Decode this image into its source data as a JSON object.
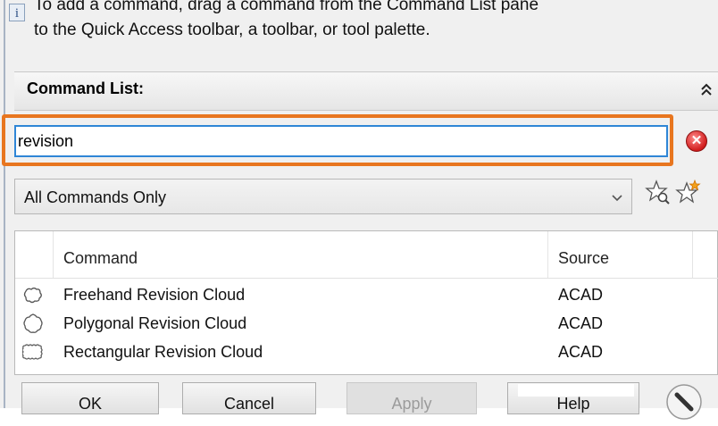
{
  "info": {
    "line1": "To add a command, drag a command from the Command List pane",
    "line2": "to the Quick Access toolbar, a toolbar, or tool palette."
  },
  "command_list": {
    "title": "Command List:"
  },
  "search": {
    "value": "revision"
  },
  "filter": {
    "selected": "All Commands Only"
  },
  "table": {
    "columns": [
      "Command",
      "Source"
    ],
    "rows": [
      {
        "icon": "freehand-revision-cloud-icon",
        "command": "Freehand Revision Cloud",
        "source": "ACAD"
      },
      {
        "icon": "polygonal-revision-cloud-icon",
        "command": "Polygonal Revision Cloud",
        "source": "ACAD"
      },
      {
        "icon": "rectangular-revision-cloud-icon",
        "command": "Rectangular Revision Cloud",
        "source": "ACAD"
      }
    ]
  },
  "buttons": {
    "ok": "OK",
    "cancel": "Cancel",
    "apply": "Apply",
    "help": "Help"
  },
  "colors": {
    "highlight": "#e8761f",
    "focus_border": "#2f86d6"
  }
}
